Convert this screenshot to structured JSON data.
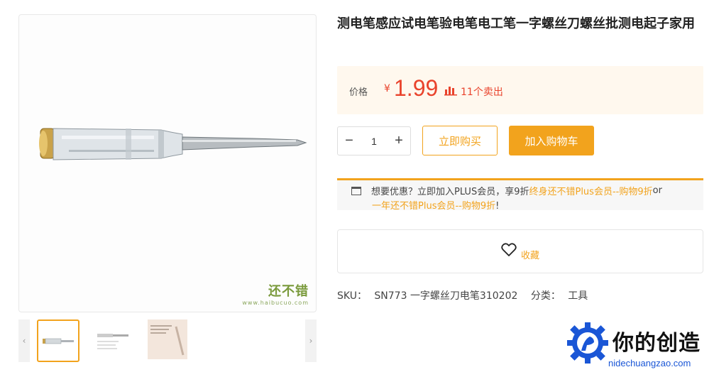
{
  "product": {
    "title": "测电笔感应试电笔验电笔电工笔一字螺丝刀螺丝批测电起子家用",
    "price_label": "价格",
    "currency": "¥",
    "price": "1.99",
    "sold": "11个卖出"
  },
  "gallery": {
    "watermark_cn": "还不错",
    "watermark_url": "www.haibucuo.com",
    "thumb_count": 3,
    "active_thumb": 0
  },
  "purchase": {
    "qty_minus": "−",
    "qty_value": "1",
    "qty_plus": "+",
    "buy_now": "立即购买",
    "add_cart": "加入购物车"
  },
  "plus_promo": {
    "text1": "想要优惠？立即加入PLUS会员，享9折 ",
    "link1": "终身还不错Plus会员--购物9折",
    "or": " or",
    "link2": "一年还不错Plus会员--购物9折",
    "tail": "!"
  },
  "favorite": {
    "label": "收藏"
  },
  "meta": {
    "sku_label": "SKU：",
    "sku_value": "SN773 一字螺丝刀电笔310202",
    "category_label": "分类：",
    "category_value": "工具"
  },
  "site_logo": {
    "name": "你的创造",
    "url": "nidechuangzao.com"
  },
  "colors": {
    "accent": "#f2a31d",
    "price": "#e9432c",
    "logo_blue": "#1a56d6"
  }
}
